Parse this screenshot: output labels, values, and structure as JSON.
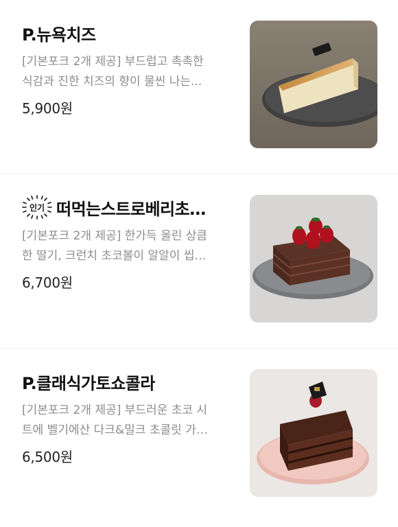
{
  "menu": {
    "items": [
      {
        "name": "P.뉴욕치즈",
        "badge": null,
        "desc_lines": [
          "[기본포크 2개 제공] 부드럽고 촉촉한",
          "식감과 진한 치즈의 향이 물씬 나는..."
        ],
        "price": "5,900원",
        "image": "cheesecake-image"
      },
      {
        "name": "떠먹는스트로베리초…",
        "badge": "인기",
        "desc_lines": [
          "[기본포크 2개 제공] 한가득 올린 상큼",
          "한 딸기, 크런치 초코볼이 알알이 씹…"
        ],
        "price": "6,700원",
        "image": "strawberry-chocolate-cake-image"
      },
      {
        "name": "P.클래식가토쇼콜라",
        "badge": null,
        "desc_lines": [
          "[기본포크 2개 제공] 부드러운 초코 시",
          "트에 벨기에산 다크&밀크 초콜릿 가…"
        ],
        "price": "6,500원",
        "image": "gateau-chocolat-image"
      }
    ]
  },
  "colors": {
    "title": "#111111",
    "desc": "#8c8c8c",
    "divider": "#ececec"
  }
}
